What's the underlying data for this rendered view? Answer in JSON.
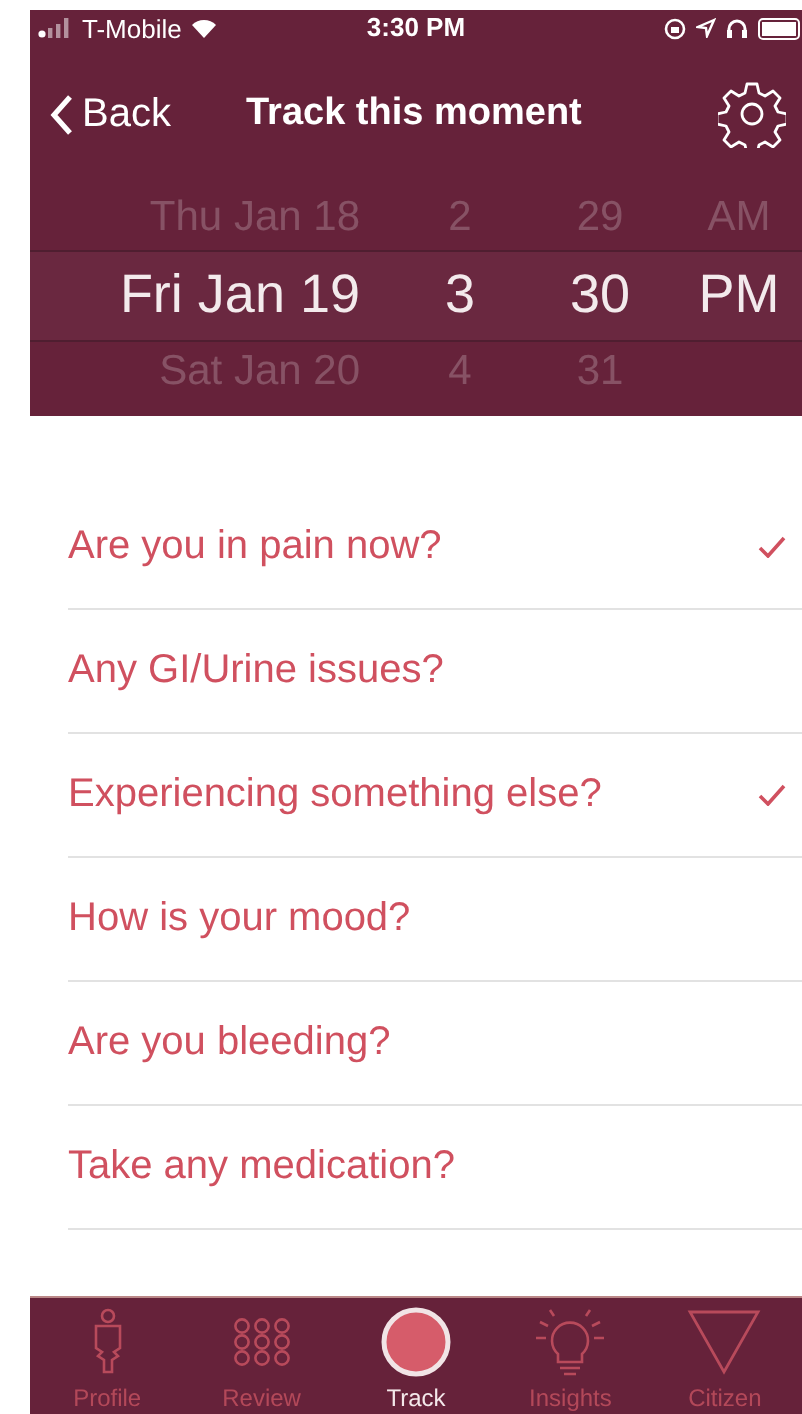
{
  "status_bar": {
    "carrier": "T-Mobile",
    "time": "3:30 PM"
  },
  "nav": {
    "back": "Back",
    "title": "Track this moment"
  },
  "picker": {
    "columns": [
      {
        "items": [
          {
            "text": "Thu Jan 18",
            "selected": false
          },
          {
            "text": "Fri Jan 19",
            "selected": true
          },
          {
            "text": "Sat Jan 20",
            "selected": false
          }
        ]
      },
      {
        "items": [
          {
            "text": "2",
            "selected": false
          },
          {
            "text": "3",
            "selected": true
          },
          {
            "text": "4",
            "selected": false
          }
        ]
      },
      {
        "items": [
          {
            "text": "29",
            "selected": false
          },
          {
            "text": "30",
            "selected": true
          },
          {
            "text": "31",
            "selected": false
          }
        ]
      },
      {
        "items": [
          {
            "text": "AM",
            "selected": false
          },
          {
            "text": "PM",
            "selected": true
          }
        ]
      }
    ]
  },
  "questions": [
    {
      "label": "Are you in pain now?",
      "checked": true
    },
    {
      "label": "Any GI/Urine issues?",
      "checked": false
    },
    {
      "label": "Experiencing something else?",
      "checked": true
    },
    {
      "label": "How is your mood?",
      "checked": false
    },
    {
      "label": "Are you bleeding?",
      "checked": false
    },
    {
      "label": "Take any medication?",
      "checked": false
    }
  ],
  "tabs": [
    {
      "label": "Profile",
      "kind": "profile",
      "selected": false
    },
    {
      "label": "Review",
      "kind": "review",
      "selected": false
    },
    {
      "label": "Track",
      "kind": "track",
      "selected": true
    },
    {
      "label": "Insights",
      "kind": "insights",
      "selected": false
    },
    {
      "label": "Citizen",
      "kind": "citizen",
      "selected": false
    }
  ]
}
